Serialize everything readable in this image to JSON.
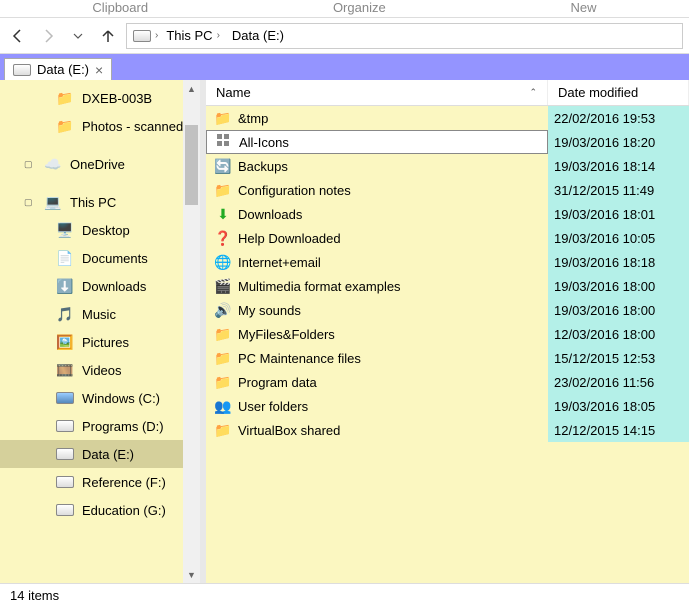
{
  "ribbon": {
    "hints": [
      "Clipboard",
      "Organize",
      "New"
    ]
  },
  "nav": {
    "breadcrumb": [
      {
        "label": "This PC"
      },
      {
        "label": "Data (E:)"
      }
    ]
  },
  "tab": {
    "label": "Data (E:)"
  },
  "sidebar": {
    "items": [
      {
        "label": "DXEB-003B",
        "indent": 1,
        "icon": "folder"
      },
      {
        "label": "Photos - scanned",
        "indent": 1,
        "icon": "folder"
      },
      {
        "label": "OneDrive",
        "indent": 0,
        "icon": "onedrive",
        "exp": true
      },
      {
        "label": "This PC",
        "indent": 0,
        "icon": "thispc",
        "exp": true
      },
      {
        "label": "Desktop",
        "indent": 1,
        "icon": "desktop"
      },
      {
        "label": "Documents",
        "indent": 1,
        "icon": "documents"
      },
      {
        "label": "Downloads",
        "indent": 1,
        "icon": "downloads"
      },
      {
        "label": "Music",
        "indent": 1,
        "icon": "music"
      },
      {
        "label": "Pictures",
        "indent": 1,
        "icon": "pictures"
      },
      {
        "label": "Videos",
        "indent": 1,
        "icon": "videos"
      },
      {
        "label": "Windows (C:)",
        "indent": 1,
        "icon": "drive-c"
      },
      {
        "label": "Programs (D:)",
        "indent": 1,
        "icon": "drive"
      },
      {
        "label": "Data (E:)",
        "indent": 1,
        "icon": "drive",
        "selected": true
      },
      {
        "label": "Reference (F:)",
        "indent": 1,
        "icon": "drive"
      },
      {
        "label": "Education (G:)",
        "indent": 1,
        "icon": "drive"
      }
    ]
  },
  "columns": {
    "name": "Name",
    "date": "Date modified"
  },
  "files": [
    {
      "name": "&tmp",
      "date": "22/02/2016 19:53",
      "icon": "folder"
    },
    {
      "name": "All-Icons",
      "date": "19/03/2016 18:20",
      "icon": "allicons",
      "selected": true
    },
    {
      "name": "Backups",
      "date": "19/03/2016 18:14",
      "icon": "backups"
    },
    {
      "name": "Configuration notes",
      "date": "31/12/2015 11:49",
      "icon": "folder"
    },
    {
      "name": "Downloads",
      "date": "19/03/2016 18:01",
      "icon": "downloads-green"
    },
    {
      "name": "Help Downloaded",
      "date": "19/03/2016 10:05",
      "icon": "help"
    },
    {
      "name": "Internet+email",
      "date": "19/03/2016 18:18",
      "icon": "internet"
    },
    {
      "name": "Multimedia format examples",
      "date": "19/03/2016 18:00",
      "icon": "multimedia"
    },
    {
      "name": "My sounds",
      "date": "19/03/2016 18:00",
      "icon": "sounds"
    },
    {
      "name": "MyFiles&Folders",
      "date": "12/03/2016 18:00",
      "icon": "folder"
    },
    {
      "name": "PC Maintenance files",
      "date": "15/12/2015 12:53",
      "icon": "folder"
    },
    {
      "name": "Program data",
      "date": "23/02/2016 11:56",
      "icon": "folder"
    },
    {
      "name": "User folders",
      "date": "19/03/2016 18:05",
      "icon": "users"
    },
    {
      "name": "VirtualBox shared",
      "date": "12/12/2015 14:15",
      "icon": "folder"
    }
  ],
  "status": {
    "count": "14 items"
  }
}
